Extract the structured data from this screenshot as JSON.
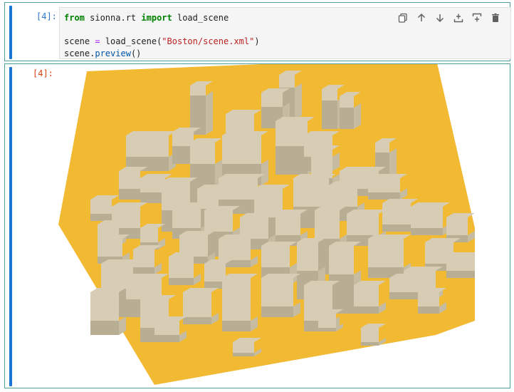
{
  "input_cell": {
    "prompt": "[4]:",
    "code": {
      "line1": {
        "kw_from": "from",
        "module": " sionna.rt ",
        "kw_import": "import",
        "name": " load_scene"
      },
      "line3": {
        "var": "scene ",
        "eq": "=",
        "call": " load_scene(",
        "str": "\"Boston/scene.xml\"",
        "close": ")"
      },
      "line4": {
        "obj": "scene.",
        "method": "preview",
        "args": "()"
      }
    },
    "toolbar": [
      {
        "name": "copy-icon"
      },
      {
        "name": "arrow-up-icon"
      },
      {
        "name": "arrow-down-icon"
      },
      {
        "name": "insert-above-icon"
      },
      {
        "name": "insert-below-icon"
      },
      {
        "name": "trash-icon"
      }
    ]
  },
  "output_cell": {
    "prompt": "[4]:",
    "preview": "3D scene preview"
  },
  "colors": {
    "accent_bar": "#1976d2",
    "ground": "#f2b933",
    "building": "#d6cdb4",
    "building_side": "#b8ae94",
    "prompt_in": "#3077c9",
    "prompt_out": "#d84315"
  }
}
